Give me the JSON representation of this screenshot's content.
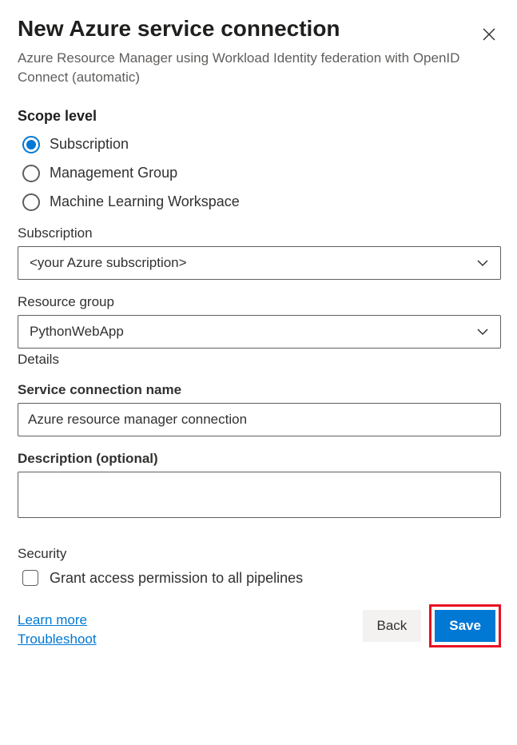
{
  "header": {
    "title": "New Azure service connection",
    "subtitle": "Azure Resource Manager using Workload Identity federation with OpenID Connect (automatic)"
  },
  "scope": {
    "heading": "Scope level",
    "options": {
      "subscription": "Subscription",
      "management_group": "Management Group",
      "ml_workspace": "Machine Learning Workspace"
    }
  },
  "subscription": {
    "label": "Subscription",
    "value": "<your Azure subscription>"
  },
  "resource_group": {
    "label": "Resource group",
    "value": "PythonWebApp",
    "helper": "Details"
  },
  "connection_name": {
    "label": "Service connection name",
    "value": "Azure resource manager connection"
  },
  "description": {
    "label": "Description (optional)",
    "value": ""
  },
  "security": {
    "heading": "Security",
    "checkbox_label": "Grant access permission to all pipelines"
  },
  "footer": {
    "learn_more": "Learn more",
    "troubleshoot": "Troubleshoot",
    "back": "Back",
    "save": "Save"
  }
}
